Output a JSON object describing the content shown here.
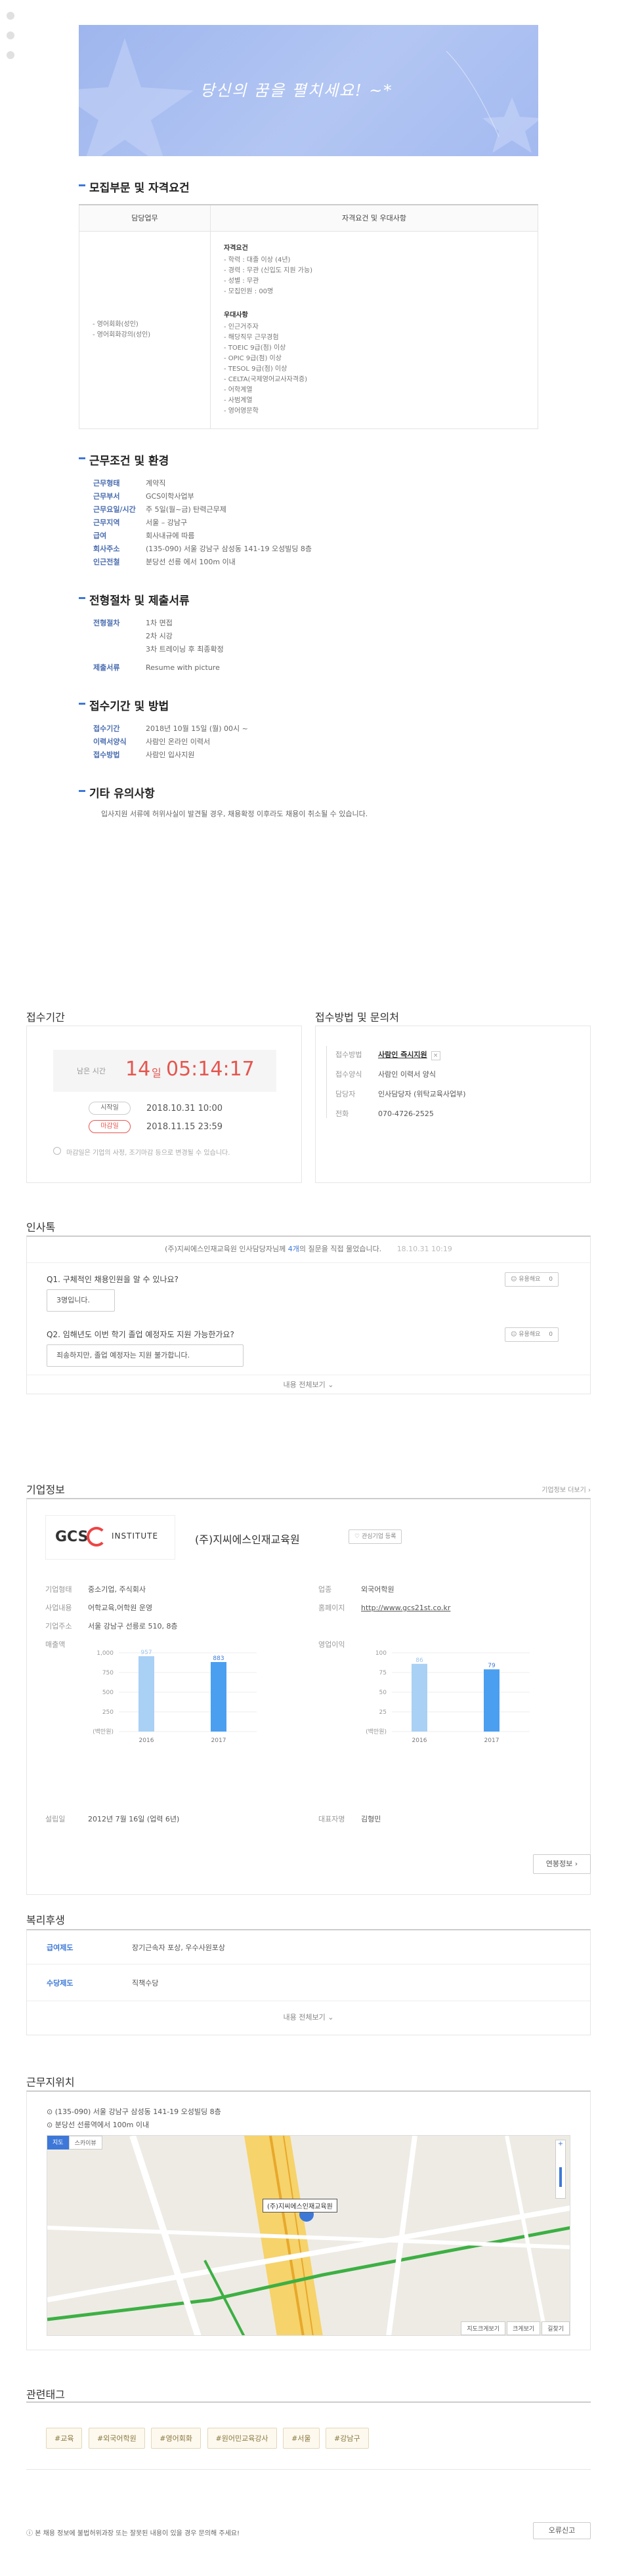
{
  "banner": {
    "text": "당신의 꿈을 펼치세요! ~*"
  },
  "sections": {
    "s1": "모집부문 및 자격요건",
    "s2": "근무조건 및 환경",
    "s3": "전형절차 및 제출서류",
    "s4": "접수기간 및 방법",
    "s5": "기타 유의사항"
  },
  "req_table": {
    "col1": "담당업무",
    "col2": "자격요건 및 우대사항",
    "duties": [
      "- 영어회화(성인)",
      "- 영어회화강의(성인)"
    ],
    "qual_title": "자격요건",
    "quals": [
      "- 학력 : 대졸 이상 (4년)",
      "- 경력 : 무관 (신입도 지원 가능)",
      "- 성별 : 무관",
      "- 모집인원 : 00명"
    ],
    "pref_title": "우대사항",
    "prefs": [
      "- 인근거주자",
      "- 해당직무 근무경험",
      "- TOEIC 9급(점) 이상",
      "- OPIC 9급(점) 이상",
      "- TESOL 9급(점) 이상",
      "- CELTA(국제영어교사자격증)",
      "- 어학계열",
      "- 사범계열",
      "- 영어영문학"
    ]
  },
  "work": [
    {
      "k": "근무형태",
      "v": "계약직"
    },
    {
      "k": "근무부서",
      "v": "GCS이학사업부"
    },
    {
      "k": "근무요일/시간",
      "v": "주 5일(월~금) 탄력근무제"
    },
    {
      "k": "근무지역",
      "v": "서울 – 강남구"
    },
    {
      "k": "급여",
      "v": "회사내규에 따름"
    },
    {
      "k": "회사주소",
      "v": "(135-090) 서울 강남구 삼성동 141-19 오성빌딩 8층"
    },
    {
      "k": "인근전철",
      "v": "분당선 선릉 에서 100m 이내"
    }
  ],
  "process": [
    {
      "k": "전형절차",
      "v": "1차 면접"
    },
    {
      "k": "",
      "v": "2차 시강"
    },
    {
      "k": "",
      "v": "3차 트레이닝 후 최종확정"
    },
    {
      "k": "제출서류",
      "v": "Resume with picture"
    }
  ],
  "apply": [
    {
      "k": "접수기간",
      "v": "2018년 10월 15일 (월) 00시 ~"
    },
    {
      "k": "이력서양식",
      "v": "사람인 온라인 이력서"
    },
    {
      "k": "접수방법",
      "v": "사람인 입사지원"
    }
  ],
  "etc_note": "입사지원 서류에 허위사실이 발견될 경우, 채용확정 이후라도 채용이 취소될 수 있습니다.",
  "period": {
    "title": "접수기간",
    "remain_label": "남은 시간",
    "days": "14",
    "day_unit": "일",
    "time": "05:14:17",
    "start_label": "시작일",
    "start": "2018.10.31 10:00",
    "end_label": "마감일",
    "end": "2018.11.15 23:59",
    "note": "마감일은 기업의 사정, 조기마감 등으로 변경될 수 있습니다."
  },
  "method": {
    "title": "접수방법 및 문의처",
    "rows": [
      {
        "k": "접수방법",
        "v": "사람인 즉시지원"
      },
      {
        "k": "접수양식",
        "v": "사람인 이력서 양식"
      },
      {
        "k": "담당자",
        "v": "인사담당자 (위탁교육사업부)"
      },
      {
        "k": "전화",
        "v": "070-4726-2525"
      }
    ]
  },
  "qa": {
    "title": "인사톡",
    "intro_company": "(주)지씨에스인재교육원",
    "intro_mid": " 인사담당자님께 ",
    "intro_count": "4개",
    "intro_end": "의 질문을 직접 물었습니다.",
    "intro_date": "18.10.31 10:19",
    "items": [
      {
        "q": "Q1. 구체적인 채용인원을 알 수 있나요?",
        "a": "3명입니다.",
        "useful": "유용해요",
        "count": "0"
      },
      {
        "q": "Q2. 임해년도 이번 학기 졸업 예정자도 지원 가능한가요?",
        "a": "죄송하지만, 졸업 예정자는 지원 불가합니다.",
        "useful": "유용해요",
        "count": "0"
      }
    ],
    "more": "내용 전체보기"
  },
  "company": {
    "title": "기업정보",
    "more": "기업정보 더보기",
    "logo_text": "GCS",
    "logo_sub": "INSTITUTE",
    "name": "(주)지씨에스인재교육원",
    "follow": "관심기업 등록",
    "left": [
      {
        "k": "기업형태",
        "v": "중소기업, 주식회사"
      },
      {
        "k": "사업내용",
        "v": "어학교육,어학원 운영"
      },
      {
        "k": "기업주소",
        "v": "서울 강남구 선릉로 510, 8층"
      }
    ],
    "right": [
      {
        "k": "업종",
        "v": "외국어학원"
      },
      {
        "k": "홈페이지",
        "v": "http://www.gcs21st.co.kr"
      }
    ],
    "sales_label": "매출액",
    "profit_label": "영업이익",
    "unit": "(백만원)",
    "found_label": "설립일",
    "found": "2012년 7월 16일 (업력 6년)",
    "ceo_label": "대표자명",
    "ceo": "김형민",
    "annual": "연봉정보"
  },
  "chart_data": [
    {
      "type": "bar",
      "categories": [
        "2016",
        "2017"
      ],
      "values": [
        957,
        883
      ],
      "ylim": [
        0,
        1000
      ],
      "yticks": [
        "1,000",
        "750",
        "500",
        "250",
        "(백만원)"
      ]
    },
    {
      "type": "bar",
      "categories": [
        "2016",
        "2017"
      ],
      "values": [
        86,
        79
      ],
      "ylim": [
        0,
        100
      ],
      "yticks": [
        "100",
        "75",
        "50",
        "25",
        "(백만원)"
      ]
    }
  ],
  "welfare": {
    "title": "복리후생",
    "rows": [
      {
        "k": "급여제도",
        "v": "장기근속자 포상, 우수사원포상"
      },
      {
        "k": "수당제도",
        "v": "직책수당"
      }
    ],
    "more": "내용 전체보기"
  },
  "location": {
    "title": "근무지위치",
    "addr": "(135-090) 서울 강남구 삼성동 141-19 오성빌딩 8층",
    "subway": "분당선 선릉역에서 100m 이내",
    "map_tab1": "지도",
    "map_tab2": "스카이뷰",
    "marker": "(주)지씨에스인재교육원",
    "btn1": "지도크게보기",
    "btn2": "길찾기",
    "btn3": "크게보기"
  },
  "tags": {
    "title": "관련태그",
    "items": [
      "#교육",
      "#외국어학원",
      "#영어회화",
      "#원어민교육강사",
      "#서울",
      "#강남구"
    ],
    "report": "본 채용 정보에 불법허위과장 또는 잘못된 내용이 있을 경우 문의해 주세요!",
    "report_btn": "오류신고"
  },
  "colors": {
    "accent": "#3d78d8",
    "red": "#e5564f"
  }
}
